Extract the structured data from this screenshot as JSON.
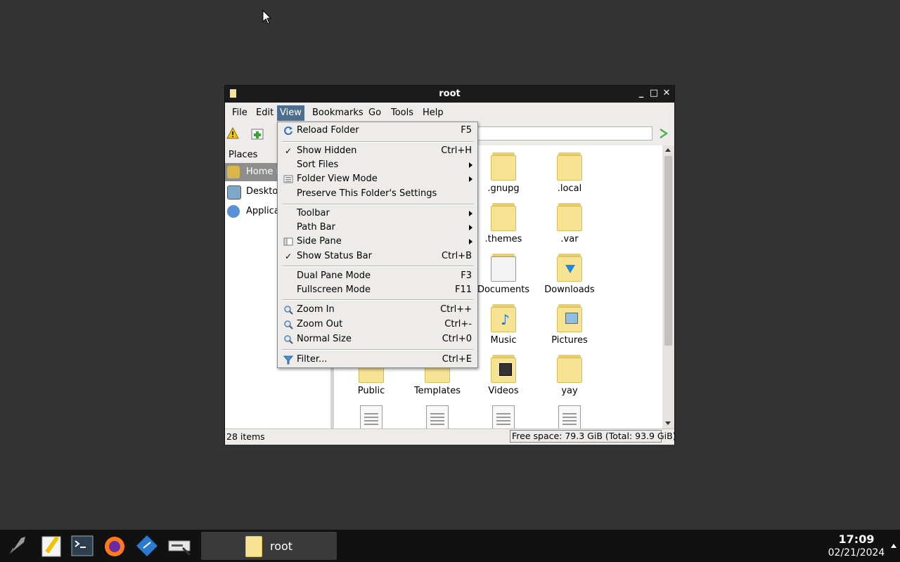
{
  "window": {
    "title": "root",
    "menubar": [
      "File",
      "Edit",
      "View",
      "Bookmarks",
      "Go",
      "Tools",
      "Help"
    ]
  },
  "sidepane": {
    "header": "Places",
    "items": [
      {
        "label": "Home Folder",
        "icon": "home-folder-icon"
      },
      {
        "label": "Desktop",
        "icon": "desktop-icon"
      },
      {
        "label": "Applications",
        "icon": "applications-icon"
      }
    ]
  },
  "files": [
    {
      "label": ".gnupg",
      "type": "folder"
    },
    {
      "label": ".local",
      "type": "folder"
    },
    {
      "label": ".themes",
      "type": "folder"
    },
    {
      "label": ".var",
      "type": "folder"
    },
    {
      "label": "Documents",
      "type": "folder"
    },
    {
      "label": "Downloads",
      "type": "folder"
    },
    {
      "label": "Music",
      "type": "folder"
    },
    {
      "label": "Pictures",
      "type": "folder"
    },
    {
      "label": "Public",
      "type": "folder"
    },
    {
      "label": "Templates",
      "type": "folder"
    },
    {
      "label": "Videos",
      "type": "folder"
    },
    {
      "label": "yay",
      "type": "folder"
    }
  ],
  "status": {
    "items": "28 items",
    "free_space": "Free space: 79.3 GiB (Total: 93.9 GiB)"
  },
  "view_menu": {
    "items": [
      {
        "label": "Reload Folder",
        "accel": "F5",
        "icon": "reload-icon"
      },
      {
        "label": "Show Hidden",
        "accel": "Ctrl+H",
        "checked": true
      },
      {
        "label": "Sort Files",
        "submenu": true
      },
      {
        "label": "Folder View Mode",
        "submenu": true,
        "icon": "view-mode-icon"
      },
      {
        "label": "Preserve This Folder's Settings"
      },
      {
        "label": "Toolbar",
        "submenu": true
      },
      {
        "label": "Path Bar",
        "submenu": true
      },
      {
        "label": "Side Pane",
        "submenu": true,
        "icon": "side-pane-icon"
      },
      {
        "label": "Show Status Bar",
        "accel": "Ctrl+B",
        "checked": true
      },
      {
        "label": "Dual Pane Mode",
        "accel": "F3"
      },
      {
        "label": "Fullscreen Mode",
        "accel": "F11"
      },
      {
        "label": "Zoom In",
        "accel": "Ctrl++",
        "icon": "zoom-in-icon"
      },
      {
        "label": "Zoom Out",
        "accel": "Ctrl+-",
        "icon": "zoom-out-icon"
      },
      {
        "label": "Normal Size",
        "accel": "Ctrl+0",
        "icon": "zoom-normal-icon"
      },
      {
        "label": "Filter...",
        "accel": "Ctrl+E",
        "icon": "filter-icon"
      }
    ],
    "check_mark": "✓"
  },
  "taskbar": {
    "window_label": "root",
    "time": "17:09",
    "date": "02/21/2024"
  },
  "colors": {
    "desktop": "#333333",
    "menu_highlight": "#4d6e8e",
    "folder": "#f7e394"
  }
}
